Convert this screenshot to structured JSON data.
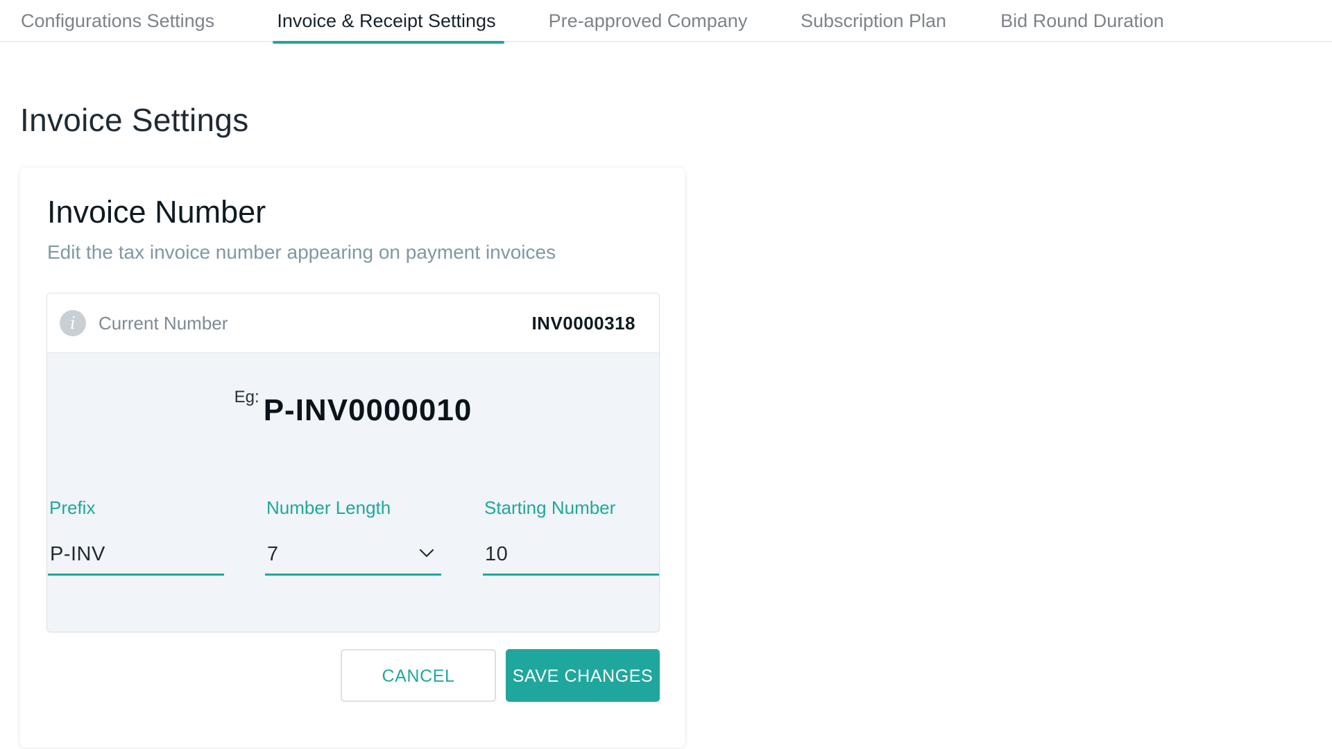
{
  "tabs": [
    {
      "label": "Configurations Settings"
    },
    {
      "label": "Invoice & Receipt Settings"
    },
    {
      "label": "Pre-approved Company"
    },
    {
      "label": "Subscription Plan"
    },
    {
      "label": "Bid Round Duration"
    }
  ],
  "page_title": "Invoice Settings",
  "card": {
    "title": "Invoice Number",
    "subtitle": "Edit the tax invoice number appearing on payment invoices",
    "info_icon_glyph": "i",
    "current_label": "Current Number",
    "current_value": "INV0000318",
    "example_label": "Eg:",
    "example_value": "P-INV0000010"
  },
  "fields": {
    "prefix": {
      "label": "Prefix",
      "value": "P-INV"
    },
    "number_length": {
      "label": "Number Length",
      "value": "7"
    },
    "starting_number": {
      "label": "Starting Number",
      "value": "10"
    }
  },
  "buttons": {
    "cancel": "CANCEL",
    "save": "SAVE CHANGES"
  },
  "colors": {
    "accent": "#1fa79d",
    "muted_text": "#7f98a3",
    "example_bg": "#f1f4f8"
  },
  "icons": {
    "info": "info-icon",
    "dropdown": "chevron-down-icon"
  }
}
